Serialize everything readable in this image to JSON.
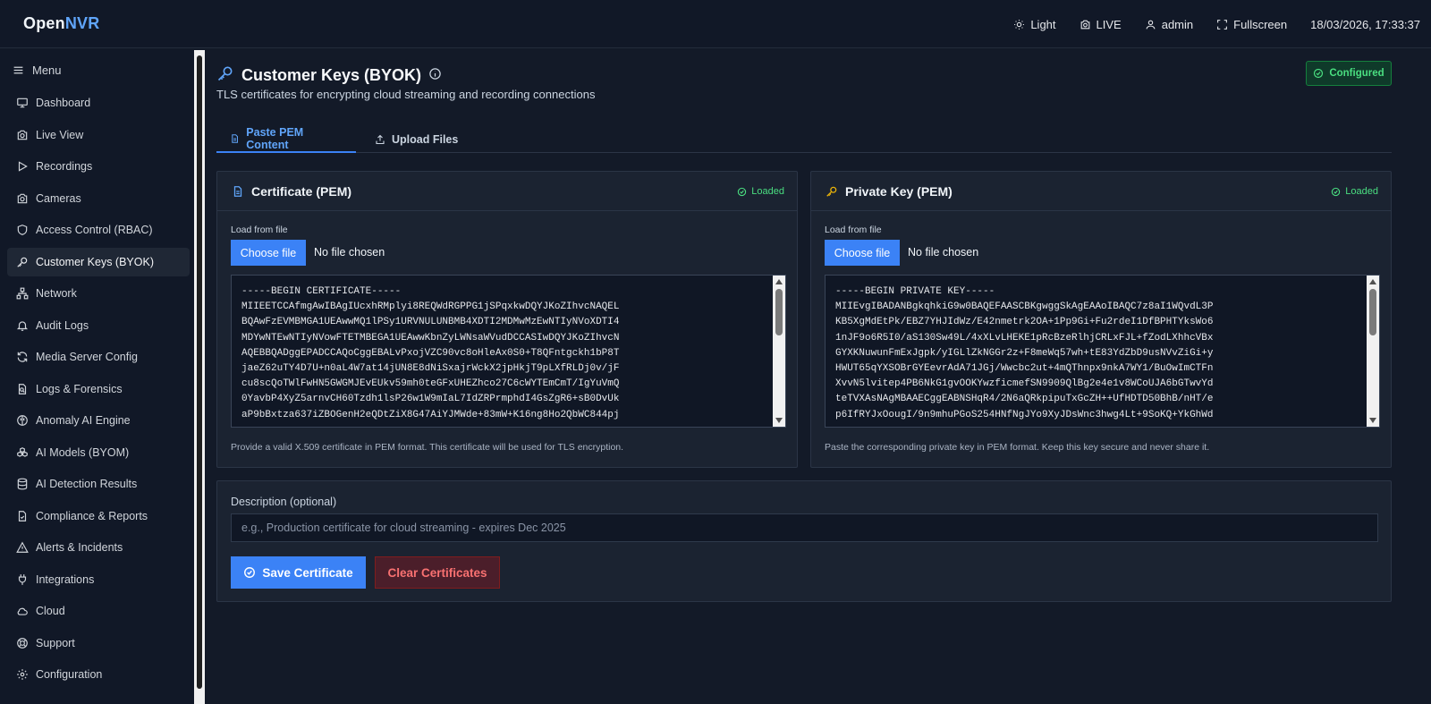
{
  "app": {
    "logo_prefix": "Open",
    "logo_accent": "NVR"
  },
  "topbar": {
    "theme_label": "Light",
    "live_label": "LIVE",
    "user_label": "admin",
    "fullscreen_label": "Fullscreen",
    "datetime": "18/03/2026, 17:33:37"
  },
  "sidebar": {
    "menu_label": "Menu",
    "items": [
      {
        "label": "Dashboard",
        "icon": "monitor-icon"
      },
      {
        "label": "Live View",
        "icon": "camera-icon"
      },
      {
        "label": "Recordings",
        "icon": "play-icon"
      },
      {
        "label": "Cameras",
        "icon": "camera-icon"
      },
      {
        "label": "Access Control (RBAC)",
        "icon": "shield-icon"
      },
      {
        "label": "Customer Keys (BYOK)",
        "icon": "key-icon"
      },
      {
        "label": "Network",
        "icon": "network-icon"
      },
      {
        "label": "Audit Logs",
        "icon": "bell-icon"
      },
      {
        "label": "Media Server Config",
        "icon": "refresh-icon"
      },
      {
        "label": "Logs & Forensics",
        "icon": "file-search-icon"
      },
      {
        "label": "Anomaly AI Engine",
        "icon": "brain-icon"
      },
      {
        "label": "AI Models (BYOM)",
        "icon": "boxes-icon"
      },
      {
        "label": "AI Detection Results",
        "icon": "database-icon"
      },
      {
        "label": "Compliance & Reports",
        "icon": "file-check-icon"
      },
      {
        "label": "Alerts & Incidents",
        "icon": "alert-triangle-icon"
      },
      {
        "label": "Integrations",
        "icon": "plug-icon"
      },
      {
        "label": "Cloud",
        "icon": "cloud-icon"
      },
      {
        "label": "Support",
        "icon": "life-buoy-icon"
      },
      {
        "label": "Configuration",
        "icon": "gear-icon"
      }
    ]
  },
  "page": {
    "title": "Customer Keys (BYOK)",
    "subtitle": "TLS certificates for encrypting cloud streaming and recording connections",
    "status_badge": "Configured"
  },
  "tabs": [
    {
      "label": "Paste PEM Content",
      "active": true
    },
    {
      "label": "Upload Files",
      "active": false
    }
  ],
  "certificate": {
    "title": "Certificate (PEM)",
    "status": "Loaded",
    "file_label": "Load from file",
    "choose_button": "Choose file",
    "file_status": "No file chosen",
    "content": "-----BEGIN CERTIFICATE-----\nMIIEETCCAfmgAwIBAgIUcxhRMplyi8REQWdRGPPG1jSPqxkwDQYJKoZIhvcNAQEL\nBQAwFzEVMBMGA1UEAwwMQ1lPSy1URVNULUNBMB4XDTI2MDMwMzEwNTIyNVoXDTI4\nMDYwNTEwNTIyNVowFTETMBEGA1UEAwwKbnZyLWNsaWVudDCCASIwDQYJKoZIhvcN\nAQEBBQADggEPADCCAQoCggEBALvPxojVZC90vc8oHleAx0S0+T8QFntgckh1bP8T\njaeZ62uTY4D7U+n0aL4W7at14jUN8E8dNiSxajrWckX2jpHkjT9pLXfRLDj0v/jF\ncu8scQoTWlFwHN5GWGMJEvEUkv59mh0teGFxUHEZhco27C6cWYTEmCmT/IgYuVmQ\n0YavbP4XyZ5arnvCH60Tzdh1lsP26w1W9mIaL7IdZRPrmphdI4GsZgR6+sB0DvUk\naP9bBxtza637iZBOGenH2eQDtZiX8G47AiYJMWde+83mW+K16ng8Ho2QbWC844pj",
    "hint": "Provide a valid X.509 certificate in PEM format. This certificate will be used for TLS encryption."
  },
  "private_key": {
    "title": "Private Key (PEM)",
    "status": "Loaded",
    "file_label": "Load from file",
    "choose_button": "Choose file",
    "file_status": "No file chosen",
    "content": "-----BEGIN PRIVATE KEY-----\nMIIEvgIBADANBgkqhkiG9w0BAQEFAASCBKgwggSkAgEAAoIBAQC7z8aI1WQvdL3P\nKB5XgMdEtPk/EBZ7YHJIdWz/E42nmetrk2OA+1Pp9Gi+Fu2rdeI1DfBPHTYksWo6\n1nJF9o6R5I0/aS130Sw49L/4xXLvLHEKE1pRcBzeRlhjCRLxFJL+fZodLXhhcVBx\nGYXKNuwunFmExJgpk/yIGLlZkNGGr2z+F8meWq57wh+tE83YdZbD9usNVvZiGi+y\nHWUT65qYXSOBrGYEevrAdA71JGj/Wwcbc2ut+4mQThnpx9nkA7WY1/BuOwImCTFn\nXvvN5lvitep4PB6NkG1gvOOKYwzficmefSN9909QlBg2e4e1v8WCoUJA6bGTwvYd\nteTVXAsNAgMBAAECggEABNSHqR4/2N6aQRkpipuTxGcZH++UfHDTD50BhB/nHT/e\np6IfRYJxOougI/9n9mhuPGoS254HNfNgJYo9XyJDsWnc3hwg4Lt+9SoKQ+YkGhWd",
    "hint": "Paste the corresponding private key in PEM format. Keep this key secure and never share it."
  },
  "description": {
    "label": "Description (optional)",
    "value": "",
    "placeholder": "e.g., Production certificate for cloud streaming - expires Dec 2025"
  },
  "actions": {
    "save_label": "Save Certificate",
    "clear_label": "Clear Certificates"
  },
  "colors": {
    "accent": "#3b82f6",
    "success": "#4ade80",
    "danger": "#f87171",
    "background": "#131a28"
  }
}
